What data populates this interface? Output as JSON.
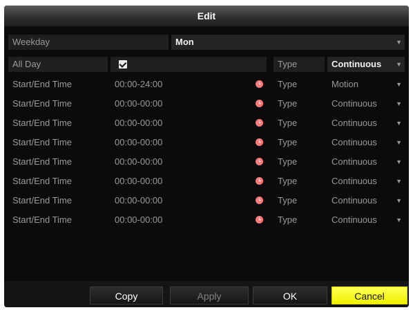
{
  "dialog": {
    "title": "Edit"
  },
  "weekday": {
    "label": "Weekday",
    "value": "Mon"
  },
  "allday": {
    "label": "All Day",
    "checked": true,
    "type_label": "Type",
    "type_value": "Continuous"
  },
  "schedule": [
    {
      "label": "Start/End Time",
      "time": "00:00-24:00",
      "type_label": "Type",
      "type_value": "Motion"
    },
    {
      "label": "Start/End Time",
      "time": "00:00-00:00",
      "type_label": "Type",
      "type_value": "Continuous"
    },
    {
      "label": "Start/End Time",
      "time": "00:00-00:00",
      "type_label": "Type",
      "type_value": "Continuous"
    },
    {
      "label": "Start/End Time",
      "time": "00:00-00:00",
      "type_label": "Type",
      "type_value": "Continuous"
    },
    {
      "label": "Start/End Time",
      "time": "00:00-00:00",
      "type_label": "Type",
      "type_value": "Continuous"
    },
    {
      "label": "Start/End Time",
      "time": "00:00-00:00",
      "type_label": "Type",
      "type_value": "Continuous"
    },
    {
      "label": "Start/End Time",
      "time": "00:00-00:00",
      "type_label": "Type",
      "type_value": "Continuous"
    },
    {
      "label": "Start/End Time",
      "time": "00:00-00:00",
      "type_label": "Type",
      "type_value": "Continuous"
    }
  ],
  "buttons": {
    "copy": "Copy",
    "apply": "Apply",
    "ok": "OK",
    "cancel": "Cancel"
  },
  "colors": {
    "accent": "#ffff33",
    "clock": "#ff7a7a"
  }
}
